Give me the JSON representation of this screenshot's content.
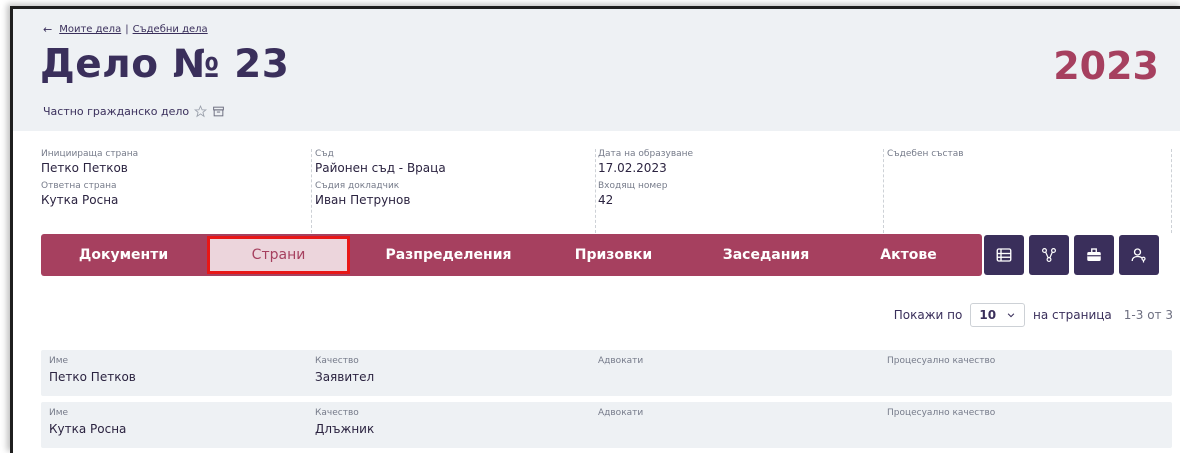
{
  "breadcrumb": {
    "back": "←",
    "my_cases": "Моите дела",
    "separator": "|",
    "court_cases": "Съдебни дела"
  },
  "case": {
    "title": "Дело № 23",
    "subtitle": "Частно гражданско дело",
    "year": "2023"
  },
  "info": {
    "initiating_party_label": "Инициираща страна",
    "initiating_party": "Петко Петков",
    "respondent_label": "Ответна страна",
    "respondent": "Кутка Росна",
    "court_label": "Съд",
    "court": "Районен съд - Враца",
    "judge_label": "Съдия докладчик",
    "judge": "Иван Петрунов",
    "created_label": "Дата на образуване",
    "created": "17.02.2023",
    "incoming_label": "Входящ номер",
    "incoming": "42",
    "panel_label": "Съдебен състав"
  },
  "tabs": [
    "Документи",
    "Страни",
    "Разпределения",
    "Призовки",
    "Заседания",
    "Актове"
  ],
  "active_tab": "Страни",
  "pager": {
    "show_label": "Покажи по",
    "page_size": "10",
    "per_page_label": "на страница",
    "range": "1-3 от 3"
  },
  "table": {
    "headers": {
      "name": "Име",
      "quality": "Качество",
      "lawyers": "Адвокати",
      "procedural": "Процесуално качество"
    },
    "rows": [
      {
        "name": "Петко Петков",
        "quality": "Заявител"
      },
      {
        "name": "Кутка Росна",
        "quality": "Длъжник"
      }
    ]
  },
  "colors": {
    "accent": "#a6405f",
    "dark": "#3a2f5b",
    "active_tab_bg": "#ecd5dc",
    "header_bg": "#eef1f4"
  }
}
